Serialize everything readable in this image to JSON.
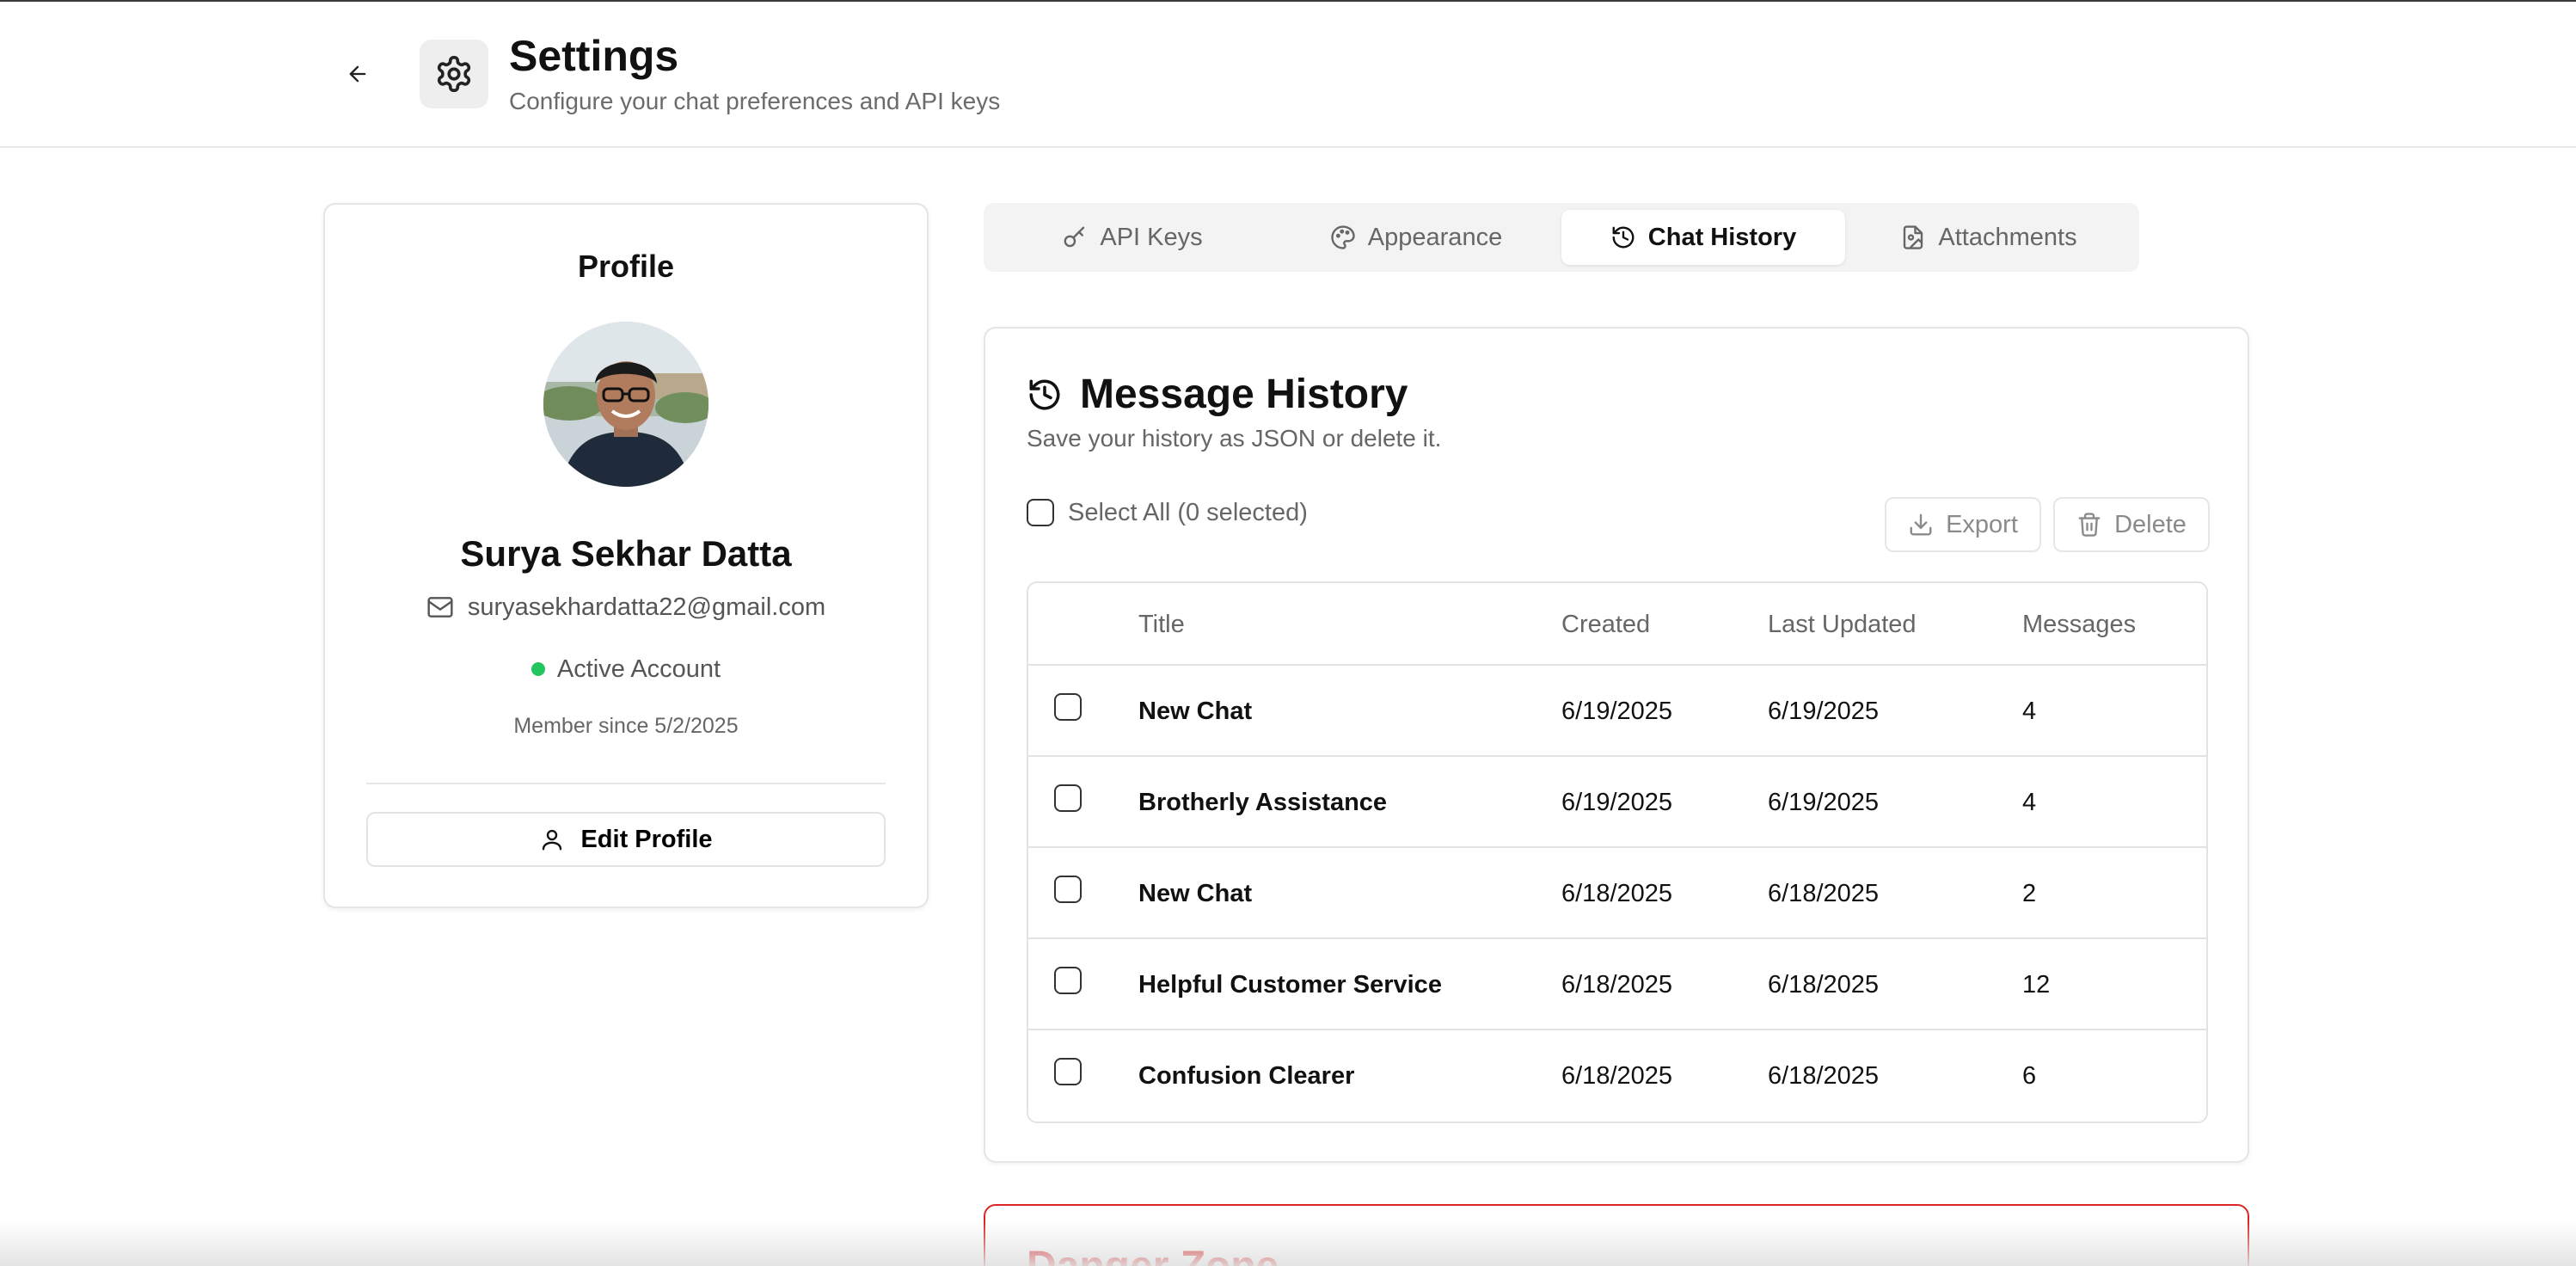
{
  "header": {
    "title": "Settings",
    "subtitle": "Configure your chat preferences and API keys"
  },
  "profile": {
    "heading": "Profile",
    "name": "Surya Sekhar Datta",
    "email": "suryasekhardatta22@gmail.com",
    "status": "Active Account",
    "member_since": "Member since 5/2/2025",
    "edit_label": "Edit Profile"
  },
  "tabs": [
    {
      "label": "API Keys",
      "icon": "key-icon"
    },
    {
      "label": "Appearance",
      "icon": "palette-icon"
    },
    {
      "label": "Chat History",
      "icon": "history-icon",
      "active": true
    },
    {
      "label": "Attachments",
      "icon": "file-image-icon"
    }
  ],
  "history": {
    "title": "Message History",
    "subtitle": "Save your history as JSON or delete it.",
    "select_all": "Select All (0 selected)",
    "export_label": "Export",
    "delete_label": "Delete",
    "columns": [
      "Title",
      "Created",
      "Last Updated",
      "Messages"
    ],
    "rows": [
      {
        "title": "New Chat",
        "created": "6/19/2025",
        "updated": "6/19/2025",
        "messages": "4"
      },
      {
        "title": "Brotherly Assistance",
        "created": "6/19/2025",
        "updated": "6/19/2025",
        "messages": "4"
      },
      {
        "title": "New Chat",
        "created": "6/18/2025",
        "updated": "6/18/2025",
        "messages": "2"
      },
      {
        "title": "Helpful Customer Service",
        "created": "6/18/2025",
        "updated": "6/18/2025",
        "messages": "12"
      },
      {
        "title": "Confusion Clearer",
        "created": "6/18/2025",
        "updated": "6/18/2025",
        "messages": "6"
      }
    ]
  },
  "danger": {
    "title": "Danger Zone"
  },
  "colors": {
    "accent_danger": "#dc2626",
    "status_active": "#22c55e",
    "tab_bg": "#f3f3f3"
  }
}
